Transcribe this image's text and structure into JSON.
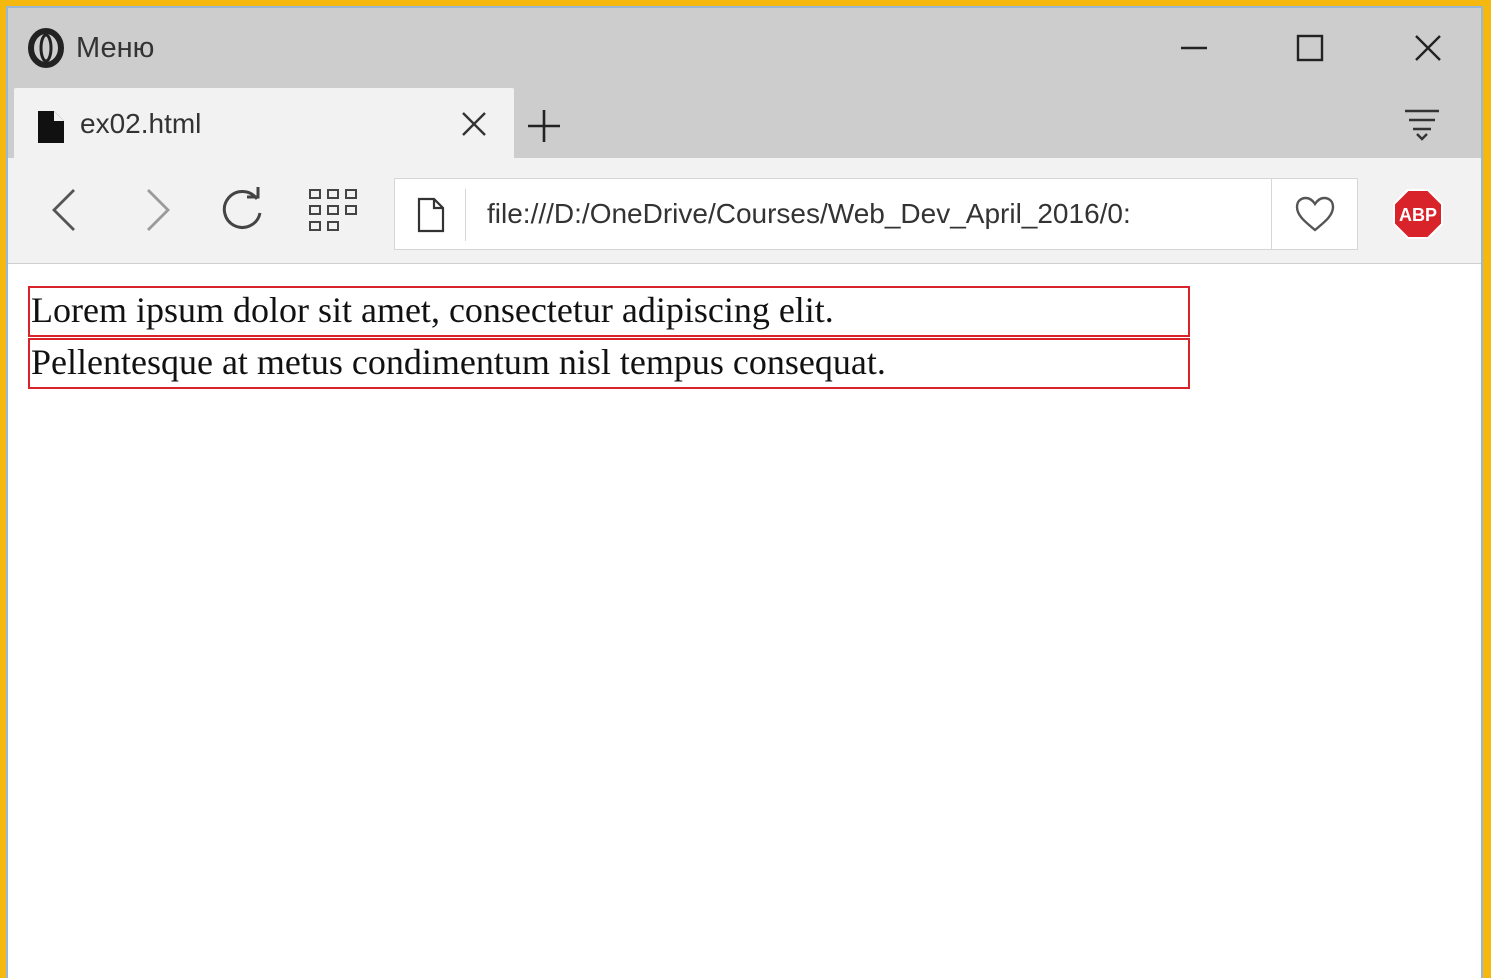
{
  "window": {
    "menu_label": "Меню",
    "controls": {
      "minimize": "minimize-icon",
      "maximize": "maximize-icon",
      "close": "close-icon"
    }
  },
  "tabs": [
    {
      "title": "ex02.html",
      "icon": "file-icon",
      "active": true
    }
  ],
  "toolbar": {
    "url": "file:///D:/OneDrive/Courses/Web_Dev_April_2016/0:",
    "icons": [
      "back-icon",
      "forward-icon",
      "reload-icon",
      "speed-dial-icon",
      "page-icon",
      "heart-icon"
    ],
    "extension": {
      "name": "adblock-plus-icon",
      "label": "ABP"
    }
  },
  "page": {
    "paragraphs": [
      "Lorem ipsum dolor sit amet, consectetur adipiscing elit.",
      "Pellentesque at metus condimentum nisl tempus consequat."
    ]
  },
  "colors": {
    "frame_accent": "#f5b80f",
    "titlebar_bg": "#cdcdcd",
    "toolbar_bg": "#f2f2f2",
    "paragraph_border": "#d9232b",
    "abp_red": "#d9232b"
  }
}
